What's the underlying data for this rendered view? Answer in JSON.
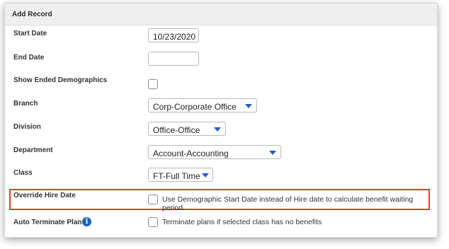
{
  "header": {
    "title": "Add Record"
  },
  "fields": {
    "start_date": {
      "label": "Start Date",
      "value": "10/23/2020"
    },
    "end_date": {
      "label": "End Date",
      "value": ""
    },
    "show_ended": {
      "label": "Show Ended Demographics"
    },
    "branch": {
      "label": "Branch",
      "value": "Corp-Corporate Office"
    },
    "division": {
      "label": "Division",
      "value": "Office-Office"
    },
    "department": {
      "label": "Department",
      "value": "Account-Accounting"
    },
    "class": {
      "label": "Class",
      "value": "FT-Full Time"
    },
    "override_hire": {
      "label": "Override Hire Date",
      "checkbox_text": "Use Demographic Start Date instead of Hire date to calculate benefit waiting period."
    },
    "auto_terminate": {
      "label": "Auto Terminate Plan",
      "checkbox_text": "Terminate plans if selected class has no benefits",
      "info_glyph": "i"
    }
  },
  "colors": {
    "accent": "#1f5fbf",
    "highlight": "#e03c31"
  }
}
